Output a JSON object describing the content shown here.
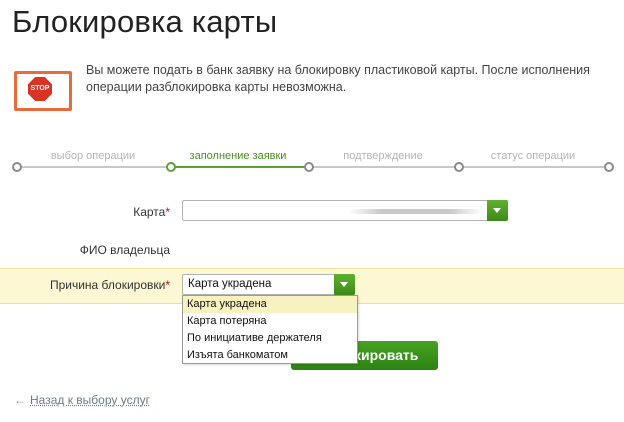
{
  "page": {
    "title": "Блокировка карты",
    "info_text": "Вы можете подать в банк заявку на блокировку пластиковой карты. После исполнения операции разблокировка карты невозможна.",
    "stop_icon_text": "STOP"
  },
  "steps": [
    {
      "label": "выбор операции",
      "state": "done"
    },
    {
      "label": "заполнение заявки",
      "state": "active"
    },
    {
      "label": "подтверждение",
      "state": "pending"
    },
    {
      "label": "статус операции",
      "state": "pending"
    }
  ],
  "form": {
    "card_label": "Карта",
    "owner_label": "ФИО владельца",
    "reason_label": "Причина блокировки",
    "required_mark": "*",
    "reason_selected": "Карта украдена",
    "reason_options": [
      "Карта украдена",
      "Карта потеряна",
      "По инициативе держателя",
      "Изъята банкоматом"
    ],
    "submit_visible_label": "кировать"
  },
  "footer": {
    "back_arrow": "←",
    "back_link": "Назад к выбору услуг"
  },
  "colors": {
    "accent_green": "#5ca132",
    "button_green": "#3d8a17",
    "stop_orange": "#e96a3a",
    "highlight_row": "#fdf8d4"
  }
}
